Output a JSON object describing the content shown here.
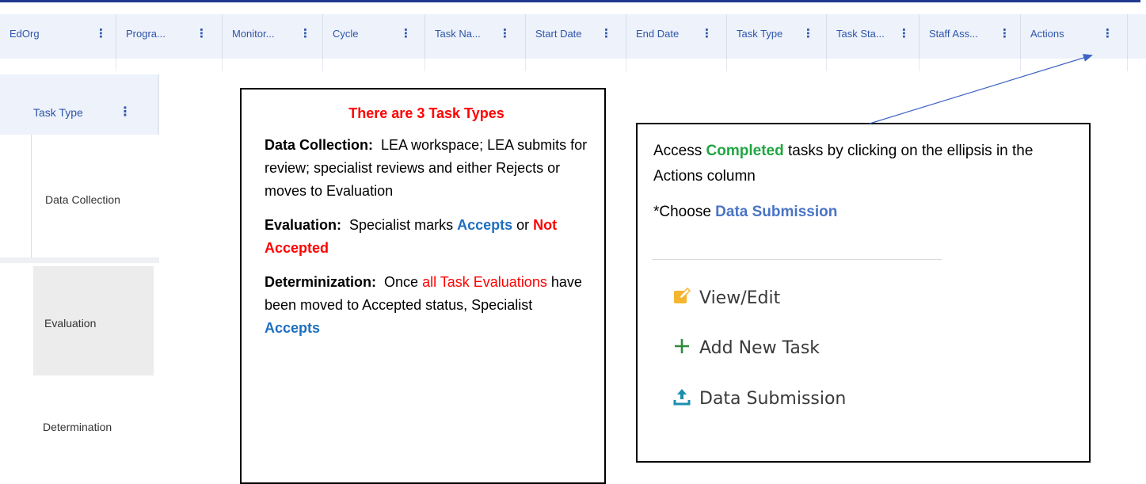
{
  "grid": {
    "columns": [
      {
        "label": "EdOrg"
      },
      {
        "label": "Progra..."
      },
      {
        "label": "Monitor..."
      },
      {
        "label": "Cycle"
      },
      {
        "label": "Task Na..."
      },
      {
        "label": "Start Date"
      },
      {
        "label": "End Date"
      },
      {
        "label": "Task Type"
      },
      {
        "label": "Task Sta..."
      },
      {
        "label": "Staff Ass..."
      },
      {
        "label": "Actions"
      }
    ],
    "menu_glyph": "⋮"
  },
  "task_type_panel": {
    "header": "Task Type",
    "menu_glyph": "⋮",
    "rows": [
      "Data Collection",
      "Evaluation",
      "Determination"
    ]
  },
  "info_box": {
    "title": "There are 3 Task Types",
    "data_collection": {
      "term": "Data Collection:",
      "text": "LEA workspace; LEA submits for review; specialist reviews and either Rejects or moves to Evaluation"
    },
    "evaluation": {
      "term": "Evaluation:",
      "text": "Specialist marks",
      "accepts": "Accepts",
      "or": "or",
      "not_accepted": "Not Accepted"
    },
    "determinization": {
      "term": "Determinization:",
      "text_pre": "Once",
      "highlight": "all Task Evaluations",
      "text_post": "have been moved to Accepted status, Specialist",
      "accepts": "Accepts"
    }
  },
  "access_box": {
    "prefix": "Access",
    "completed": "Completed",
    "suffix": "tasks by clicking on the ellipsis in the Actions column",
    "choose_prefix": "*Choose",
    "choose_target": "Data Submission",
    "menu": [
      {
        "label": "View/Edit",
        "icon": "edit-icon"
      },
      {
        "label": "Add New Task",
        "icon": "plus-icon"
      },
      {
        "label": "Data Submission",
        "icon": "upload-icon"
      }
    ]
  },
  "colors": {
    "header_bg": "#edf2fb",
    "header_text": "#2f55a8",
    "red": "#ff0000",
    "blue": "#1e6fbf",
    "green": "#21a641",
    "arrow": "#3f63c4"
  }
}
